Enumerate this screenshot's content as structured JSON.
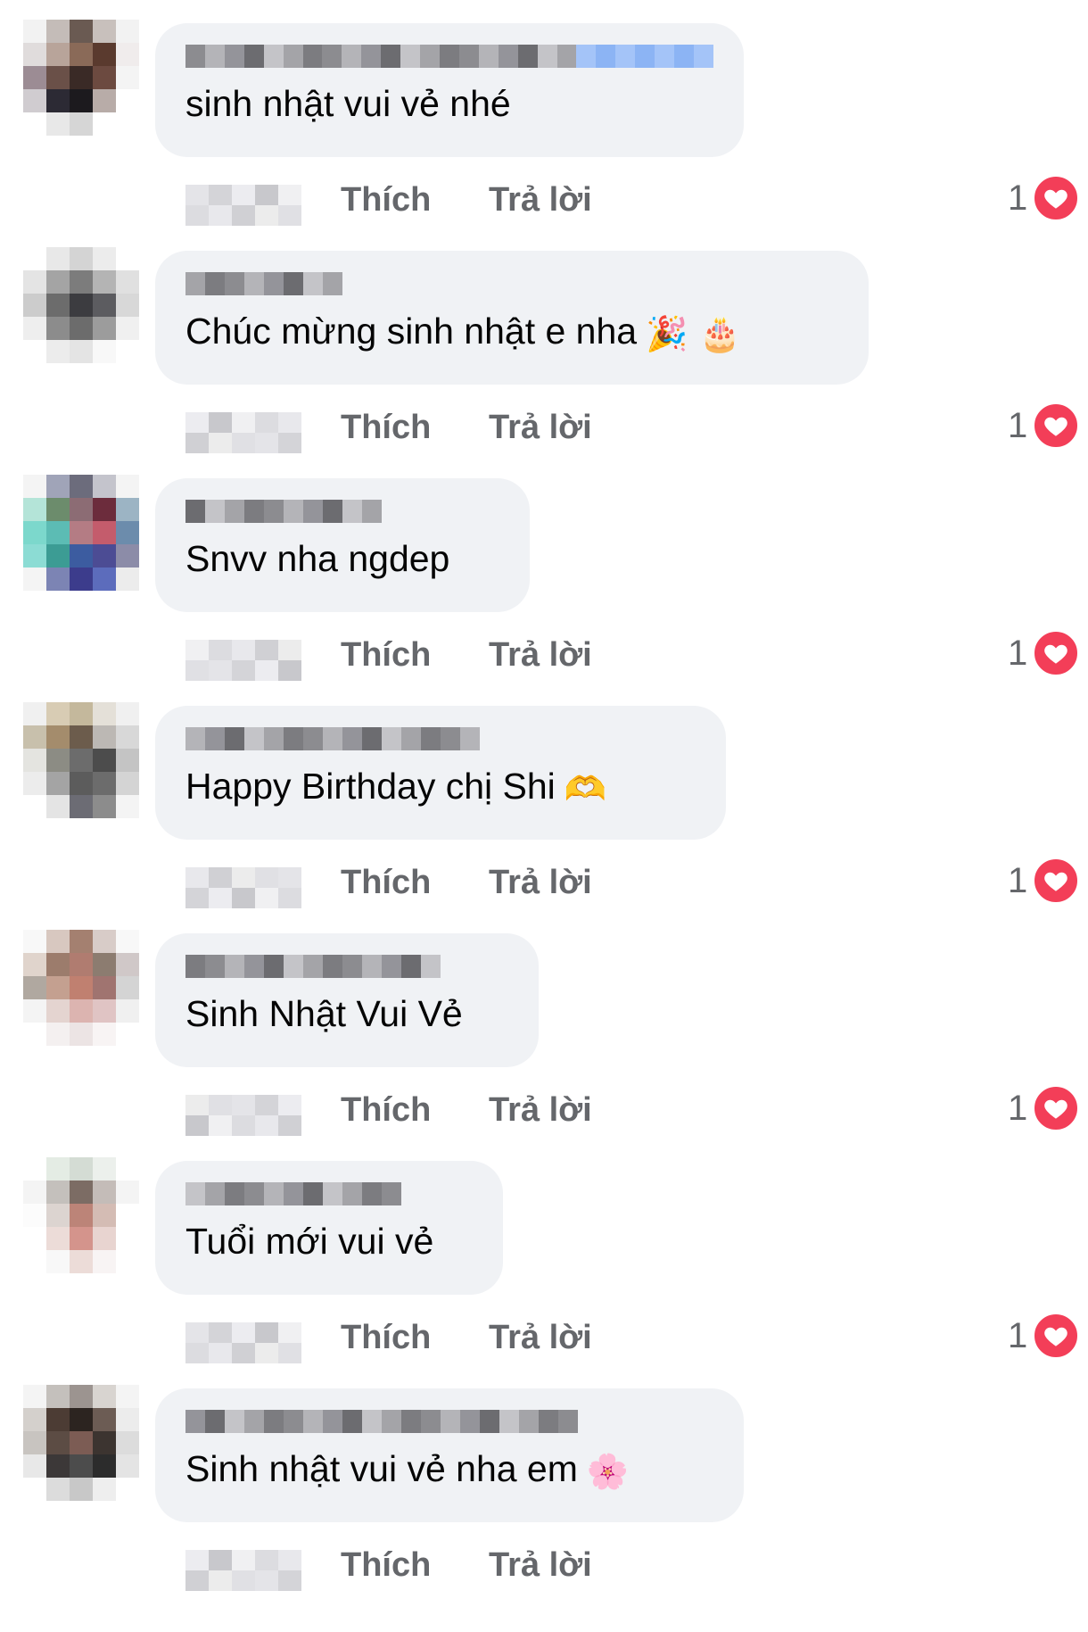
{
  "colors": {
    "bubble_bg": "#f0f2f5",
    "text": "#050505",
    "secondary_text": "#65676b",
    "heart": "#f33e58"
  },
  "comments": [
    {
      "text": "sinh nhật vui vẻ nhé",
      "emoji": "",
      "emoji_icon": "",
      "like_label": "Thích",
      "reply_label": "Trả lời",
      "reaction_count": "1",
      "reaction_icon": "heart-icon"
    },
    {
      "text": "Chúc mừng sinh nhật e nha",
      "emoji": "🎉 🎂",
      "emoji_icon": "party-popper-and-cake-icon",
      "like_label": "Thích",
      "reply_label": "Trả lời",
      "reaction_count": "1",
      "reaction_icon": "heart-icon"
    },
    {
      "text": "Snvv nha ngdep",
      "emoji": "",
      "emoji_icon": "",
      "like_label": "Thích",
      "reply_label": "Trả lời",
      "reaction_count": "1",
      "reaction_icon": "heart-icon"
    },
    {
      "text": "Happy Birthday chị Shi",
      "emoji": "🫶",
      "emoji_icon": "heart-hands-icon",
      "like_label": "Thích",
      "reply_label": "Trả lời",
      "reaction_count": "1",
      "reaction_icon": "heart-icon"
    },
    {
      "text": "Sinh Nhật Vui Vẻ",
      "emoji": "",
      "emoji_icon": "",
      "like_label": "Thích",
      "reply_label": "Trả lời",
      "reaction_count": "1",
      "reaction_icon": "heart-icon"
    },
    {
      "text": "Tuổi mới vui vẻ",
      "emoji": "",
      "emoji_icon": "",
      "like_label": "Thích",
      "reply_label": "Trả lời",
      "reaction_count": "1",
      "reaction_icon": "heart-icon"
    },
    {
      "text": "Sinh nhật vui vẻ nha em",
      "emoji": "🌸",
      "emoji_icon": "cherry-blossom-icon",
      "like_label": "Thích",
      "reply_label": "Trả lời",
      "reaction_count": "",
      "reaction_icon": ""
    }
  ]
}
